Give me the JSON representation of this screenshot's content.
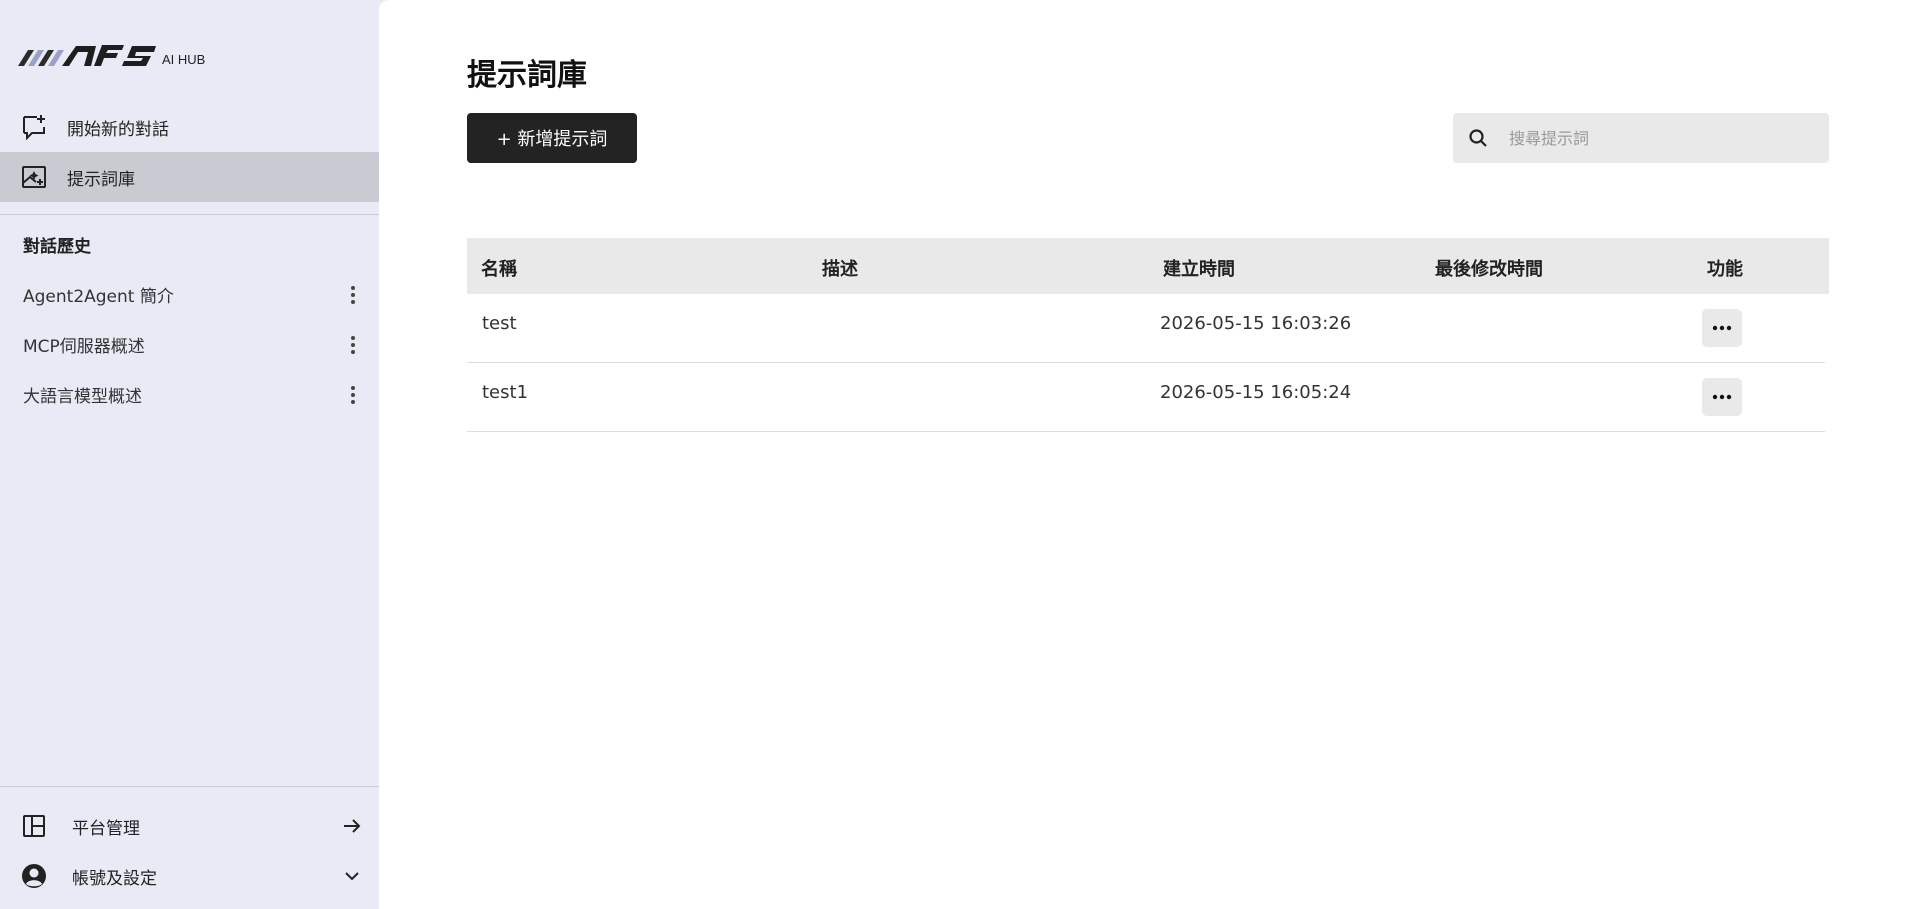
{
  "app": {
    "logo_text": "AFS",
    "logo_sub": "AI HUB"
  },
  "sidebar": {
    "nav": [
      {
        "label": "開始新的對話",
        "icon": "chat-plus-icon"
      },
      {
        "label": "提示詞庫",
        "icon": "image-sparkle-icon",
        "active": true
      }
    ],
    "history_title": "對話歷史",
    "history": [
      {
        "label": "Agent2Agent 簡介"
      },
      {
        "label": "MCP伺服器概述"
      },
      {
        "label": "大語言模型概述"
      }
    ],
    "bottom": [
      {
        "label": "平台管理",
        "icon": "layout-panel-icon",
        "trail_icon": "arrow-right-icon"
      },
      {
        "label": "帳號及設定",
        "icon": "user-circle-icon",
        "trail_icon": "chevron-down-icon"
      }
    ]
  },
  "main": {
    "title": "提示詞庫",
    "add_button": "+ 新增提示詞",
    "search": {
      "placeholder": "搜尋提示詞",
      "value": ""
    },
    "table": {
      "headers": [
        "名稱",
        "描述",
        "建立時間",
        "最後修改時間",
        "功能"
      ],
      "rows": [
        {
          "name": "test",
          "description": "",
          "created": "2026-05-15 16:03:26",
          "modified": ""
        },
        {
          "name": "test1",
          "description": "",
          "created": "2026-05-15 16:05:24",
          "modified": ""
        }
      ]
    }
  },
  "colors": {
    "sidebar_bg": "#e8ebf6",
    "active_bg": "#c9cbd3",
    "button_bg": "#232323",
    "header_bg": "#e9e9e9",
    "logo_accent": "#9aa0c8"
  }
}
